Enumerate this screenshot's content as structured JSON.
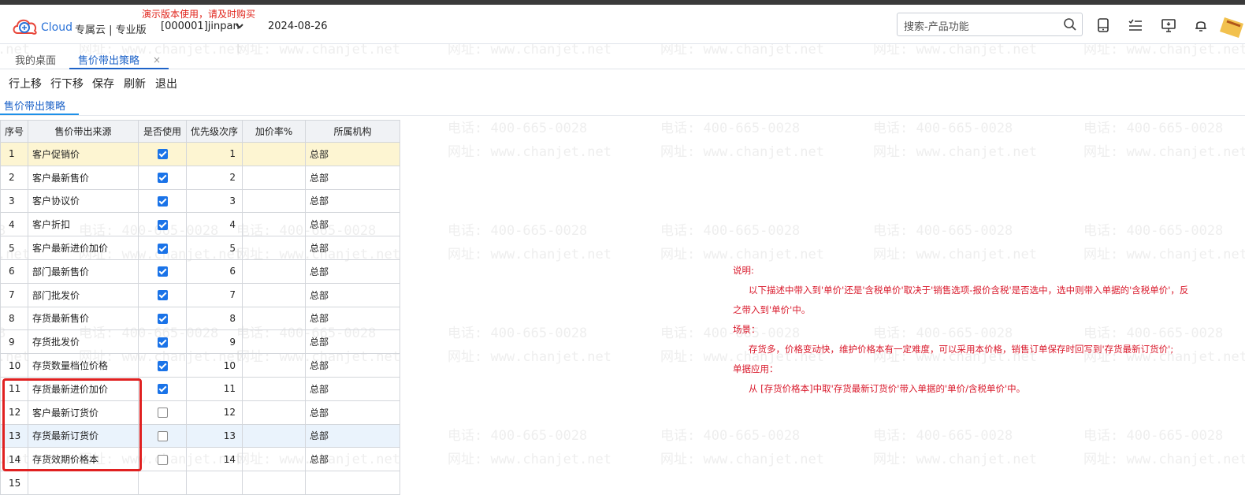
{
  "header": {
    "brand": "Cloud",
    "edition": "专属云 | 专业版",
    "demo_notice": "演示版本使用，请及时购买",
    "account": "[000001]jinpan",
    "date": "2024-08-26",
    "search_placeholder": "搜索-产品功能",
    "icons": [
      "mobile-icon",
      "task-list-icon",
      "feedback-icon",
      "bell-icon"
    ]
  },
  "tabs": [
    {
      "label": "我的桌面",
      "active": false
    },
    {
      "label": "售价带出策略",
      "active": true,
      "close": "×"
    }
  ],
  "toolbar": [
    "行上移",
    "行下移",
    "保存",
    "刷新",
    "退出"
  ],
  "section_title": "售价带出策略",
  "table": {
    "columns": [
      "序号",
      "售价带出来源",
      "是否使用",
      "优先级次序",
      "加价率%",
      "所属机构"
    ],
    "rows": [
      {
        "no": "1",
        "source": "客户促销价",
        "enabled": true,
        "priority": "1",
        "markup": "",
        "org": "总部"
      },
      {
        "no": "2",
        "source": "客户最新售价",
        "enabled": true,
        "priority": "2",
        "markup": "",
        "org": "总部"
      },
      {
        "no": "3",
        "source": "客户协议价",
        "enabled": true,
        "priority": "3",
        "markup": "",
        "org": "总部"
      },
      {
        "no": "4",
        "source": "客户折扣",
        "enabled": true,
        "priority": "4",
        "markup": "",
        "org": "总部"
      },
      {
        "no": "5",
        "source": "客户最新进价加价",
        "enabled": true,
        "priority": "5",
        "markup": "",
        "org": "总部"
      },
      {
        "no": "6",
        "source": "部门最新售价",
        "enabled": true,
        "priority": "6",
        "markup": "",
        "org": "总部"
      },
      {
        "no": "7",
        "source": "部门批发价",
        "enabled": true,
        "priority": "7",
        "markup": "",
        "org": "总部"
      },
      {
        "no": "8",
        "source": "存货最新售价",
        "enabled": true,
        "priority": "8",
        "markup": "",
        "org": "总部"
      },
      {
        "no": "9",
        "source": "存货批发价",
        "enabled": true,
        "priority": "9",
        "markup": "",
        "org": "总部"
      },
      {
        "no": "10",
        "source": "存货数量档位价格",
        "enabled": true,
        "priority": "10",
        "markup": "",
        "org": "总部"
      },
      {
        "no": "11",
        "source": "存货最新进价加价",
        "enabled": true,
        "priority": "11",
        "markup": "",
        "org": "总部"
      },
      {
        "no": "12",
        "source": "客户最新订货价",
        "enabled": false,
        "priority": "12",
        "markup": "",
        "org": "总部"
      },
      {
        "no": "13",
        "source": "存货最新订货价",
        "enabled": false,
        "priority": "13",
        "markup": "",
        "org": "总部"
      },
      {
        "no": "14",
        "source": "存货效期价格本",
        "enabled": false,
        "priority": "14",
        "markup": "",
        "org": "总部"
      },
      {
        "no": "15",
        "source": "",
        "enabled": null,
        "priority": "",
        "markup": "",
        "org": ""
      }
    ]
  },
  "note": {
    "label_desc": "说明:",
    "desc_1": "以下描述中带入到'单价'还是'含税单价'取决于'销售选项-报价含税'是否选中，选中则带入单据的'含税单价'，反",
    "desc_2": "之带入到'单价'中。",
    "label_scene": "场景：",
    "scene": "存货多，价格变动快，维护价格本有一定难度，可以采用本价格，销售订单保存时回写到'存货最新订货价';",
    "label_apply": "单据应用：",
    "apply": "从 [存货价格本]中取'存货最新订货价'带入单据的'单价/含税单价'中。"
  },
  "watermark": {
    "phone": "电话: 400-665-0028",
    "site": "网址: www.chanjet.net"
  },
  "colors": {
    "accent": "#1e63c8",
    "note_red": "#d9192b",
    "highlight_red": "#e02020",
    "selected_row": "#fdf5d2"
  }
}
